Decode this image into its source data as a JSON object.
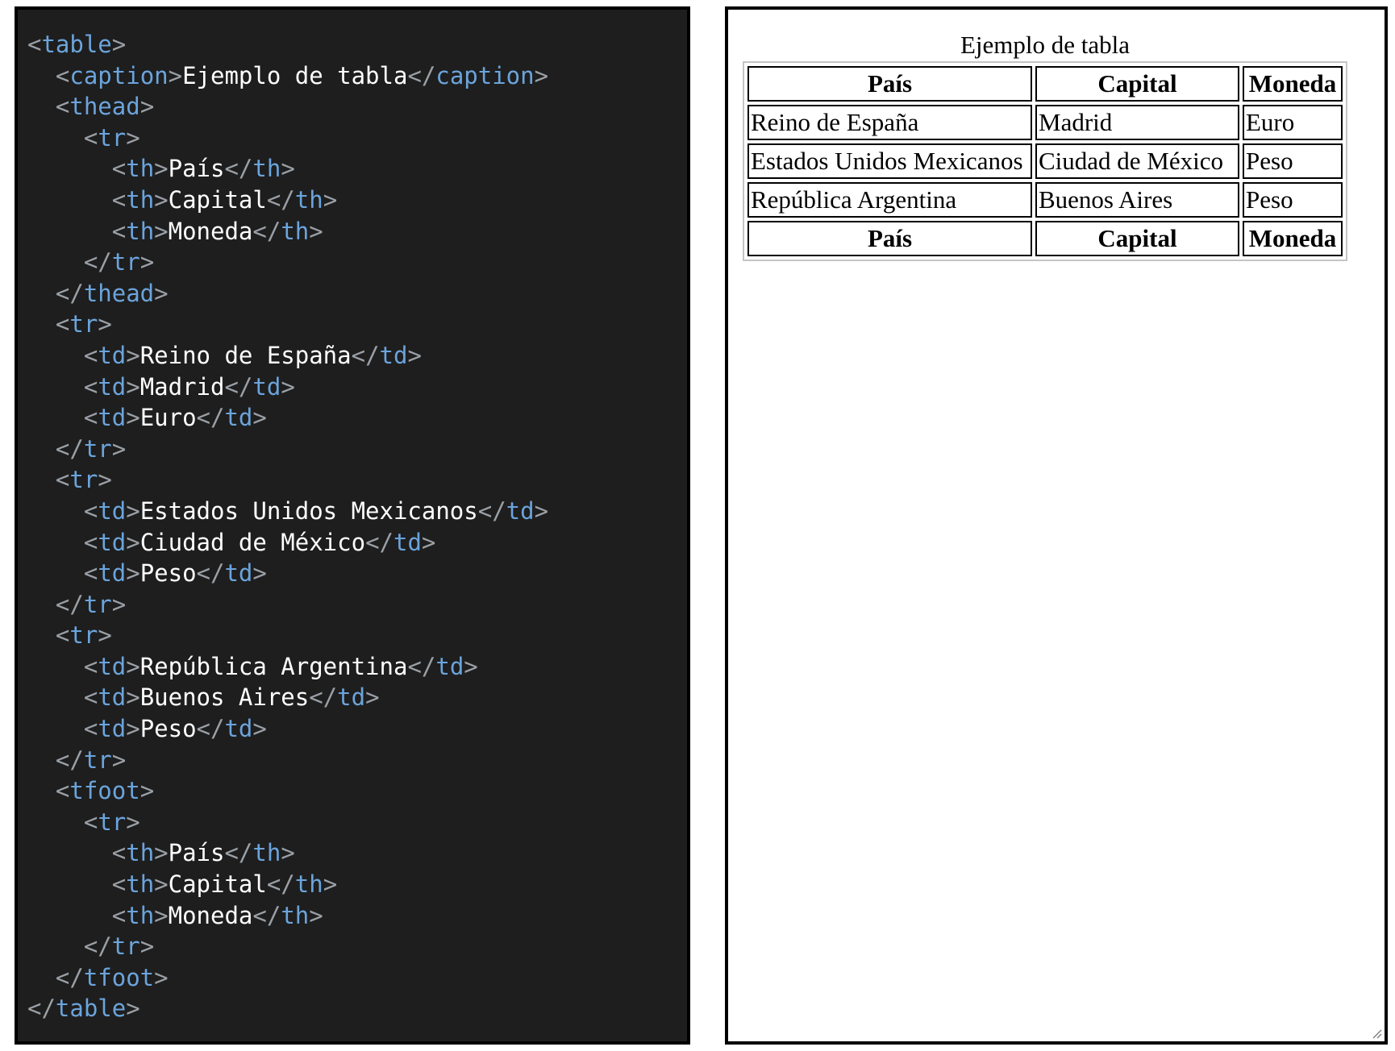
{
  "code_editor": {
    "lines": [
      {
        "indent": "",
        "parts": [
          [
            "p",
            "<"
          ],
          [
            "t",
            "table"
          ],
          [
            "p",
            ">"
          ]
        ]
      },
      {
        "indent": "  ",
        "parts": [
          [
            "p",
            "<"
          ],
          [
            "t",
            "caption"
          ],
          [
            "p",
            ">"
          ],
          [
            "x",
            "Ejemplo de tabla"
          ],
          [
            "p",
            "</"
          ],
          [
            "t",
            "caption"
          ],
          [
            "p",
            ">"
          ]
        ]
      },
      {
        "indent": "  ",
        "parts": [
          [
            "p",
            "<"
          ],
          [
            "t",
            "thead"
          ],
          [
            "p",
            ">"
          ]
        ]
      },
      {
        "indent": "    ",
        "parts": [
          [
            "p",
            "<"
          ],
          [
            "t",
            "tr"
          ],
          [
            "p",
            ">"
          ]
        ]
      },
      {
        "indent": "      ",
        "parts": [
          [
            "p",
            "<"
          ],
          [
            "t",
            "th"
          ],
          [
            "p",
            ">"
          ],
          [
            "x",
            "País"
          ],
          [
            "p",
            "</"
          ],
          [
            "t",
            "th"
          ],
          [
            "p",
            ">"
          ]
        ]
      },
      {
        "indent": "      ",
        "parts": [
          [
            "p",
            "<"
          ],
          [
            "t",
            "th"
          ],
          [
            "p",
            ">"
          ],
          [
            "x",
            "Capital"
          ],
          [
            "p",
            "</"
          ],
          [
            "t",
            "th"
          ],
          [
            "p",
            ">"
          ]
        ]
      },
      {
        "indent": "      ",
        "parts": [
          [
            "p",
            "<"
          ],
          [
            "t",
            "th"
          ],
          [
            "p",
            ">"
          ],
          [
            "x",
            "Moneda"
          ],
          [
            "p",
            "</"
          ],
          [
            "t",
            "th"
          ],
          [
            "p",
            ">"
          ]
        ]
      },
      {
        "indent": "    ",
        "parts": [
          [
            "p",
            "</"
          ],
          [
            "t",
            "tr"
          ],
          [
            "p",
            ">"
          ]
        ]
      },
      {
        "indent": "  ",
        "parts": [
          [
            "p",
            "</"
          ],
          [
            "t",
            "thead"
          ],
          [
            "p",
            ">"
          ]
        ]
      },
      {
        "indent": "  ",
        "parts": [
          [
            "p",
            "<"
          ],
          [
            "t",
            "tr"
          ],
          [
            "p",
            ">"
          ]
        ]
      },
      {
        "indent": "    ",
        "parts": [
          [
            "p",
            "<"
          ],
          [
            "t",
            "td"
          ],
          [
            "p",
            ">"
          ],
          [
            "x",
            "Reino de España"
          ],
          [
            "p",
            "</"
          ],
          [
            "t",
            "td"
          ],
          [
            "p",
            ">"
          ]
        ]
      },
      {
        "indent": "    ",
        "parts": [
          [
            "p",
            "<"
          ],
          [
            "t",
            "td"
          ],
          [
            "p",
            ">"
          ],
          [
            "x",
            "Madrid"
          ],
          [
            "p",
            "</"
          ],
          [
            "t",
            "td"
          ],
          [
            "p",
            ">"
          ]
        ]
      },
      {
        "indent": "    ",
        "parts": [
          [
            "p",
            "<"
          ],
          [
            "t",
            "td"
          ],
          [
            "p",
            ">"
          ],
          [
            "x",
            "Euro"
          ],
          [
            "p",
            "</"
          ],
          [
            "t",
            "td"
          ],
          [
            "p",
            ">"
          ]
        ]
      },
      {
        "indent": "  ",
        "parts": [
          [
            "p",
            "</"
          ],
          [
            "t",
            "tr"
          ],
          [
            "p",
            ">"
          ]
        ]
      },
      {
        "indent": "  ",
        "parts": [
          [
            "p",
            "<"
          ],
          [
            "t",
            "tr"
          ],
          [
            "p",
            ">"
          ]
        ]
      },
      {
        "indent": "    ",
        "parts": [
          [
            "p",
            "<"
          ],
          [
            "t",
            "td"
          ],
          [
            "p",
            ">"
          ],
          [
            "x",
            "Estados Unidos Mexicanos"
          ],
          [
            "p",
            "</"
          ],
          [
            "t",
            "td"
          ],
          [
            "p",
            ">"
          ]
        ]
      },
      {
        "indent": "    ",
        "parts": [
          [
            "p",
            "<"
          ],
          [
            "t",
            "td"
          ],
          [
            "p",
            ">"
          ],
          [
            "x",
            "Ciudad de México"
          ],
          [
            "p",
            "</"
          ],
          [
            "t",
            "td"
          ],
          [
            "p",
            ">"
          ]
        ]
      },
      {
        "indent": "    ",
        "parts": [
          [
            "p",
            "<"
          ],
          [
            "t",
            "td"
          ],
          [
            "p",
            ">"
          ],
          [
            "x",
            "Peso"
          ],
          [
            "p",
            "</"
          ],
          [
            "t",
            "td"
          ],
          [
            "p",
            ">"
          ]
        ]
      },
      {
        "indent": "  ",
        "parts": [
          [
            "p",
            "</"
          ],
          [
            "t",
            "tr"
          ],
          [
            "p",
            ">"
          ]
        ]
      },
      {
        "indent": "  ",
        "parts": [
          [
            "p",
            "<"
          ],
          [
            "t",
            "tr"
          ],
          [
            "p",
            ">"
          ]
        ]
      },
      {
        "indent": "    ",
        "parts": [
          [
            "p",
            "<"
          ],
          [
            "t",
            "td"
          ],
          [
            "p",
            ">"
          ],
          [
            "x",
            "República Argentina"
          ],
          [
            "p",
            "</"
          ],
          [
            "t",
            "td"
          ],
          [
            "p",
            ">"
          ]
        ]
      },
      {
        "indent": "    ",
        "parts": [
          [
            "p",
            "<"
          ],
          [
            "t",
            "td"
          ],
          [
            "p",
            ">"
          ],
          [
            "x",
            "Buenos Aires"
          ],
          [
            "p",
            "</"
          ],
          [
            "t",
            "td"
          ],
          [
            "p",
            ">"
          ]
        ]
      },
      {
        "indent": "    ",
        "parts": [
          [
            "p",
            "<"
          ],
          [
            "t",
            "td"
          ],
          [
            "p",
            ">"
          ],
          [
            "x",
            "Peso"
          ],
          [
            "p",
            "</"
          ],
          [
            "t",
            "td"
          ],
          [
            "p",
            ">"
          ]
        ]
      },
      {
        "indent": "  ",
        "parts": [
          [
            "p",
            "</"
          ],
          [
            "t",
            "tr"
          ],
          [
            "p",
            ">"
          ]
        ]
      },
      {
        "indent": "  ",
        "parts": [
          [
            "p",
            "<"
          ],
          [
            "t",
            "tfoot"
          ],
          [
            "p",
            ">"
          ]
        ]
      },
      {
        "indent": "    ",
        "parts": [
          [
            "p",
            "<"
          ],
          [
            "t",
            "tr"
          ],
          [
            "p",
            ">"
          ]
        ]
      },
      {
        "indent": "      ",
        "parts": [
          [
            "p",
            "<"
          ],
          [
            "t",
            "th"
          ],
          [
            "p",
            ">"
          ],
          [
            "x",
            "País"
          ],
          [
            "p",
            "</"
          ],
          [
            "t",
            "th"
          ],
          [
            "p",
            ">"
          ]
        ]
      },
      {
        "indent": "      ",
        "parts": [
          [
            "p",
            "<"
          ],
          [
            "t",
            "th"
          ],
          [
            "p",
            ">"
          ],
          [
            "x",
            "Capital"
          ],
          [
            "p",
            "</"
          ],
          [
            "t",
            "th"
          ],
          [
            "p",
            ">"
          ]
        ]
      },
      {
        "indent": "      ",
        "parts": [
          [
            "p",
            "<"
          ],
          [
            "t",
            "th"
          ],
          [
            "p",
            ">"
          ],
          [
            "x",
            "Moneda"
          ],
          [
            "p",
            "</"
          ],
          [
            "t",
            "th"
          ],
          [
            "p",
            ">"
          ]
        ]
      },
      {
        "indent": "    ",
        "parts": [
          [
            "p",
            "</"
          ],
          [
            "t",
            "tr"
          ],
          [
            "p",
            ">"
          ]
        ]
      },
      {
        "indent": "  ",
        "parts": [
          [
            "p",
            "</"
          ],
          [
            "t",
            "tfoot"
          ],
          [
            "p",
            ">"
          ]
        ]
      },
      {
        "indent": "",
        "parts": [
          [
            "p",
            "</"
          ],
          [
            "t",
            "table"
          ],
          [
            "p",
            ">"
          ]
        ]
      }
    ],
    "colors": {
      "background": "#1e1e1e",
      "punctuation": "#9aa0a6",
      "tag": "#6ba4dc",
      "text": "#ffffff"
    }
  },
  "preview": {
    "caption": "Ejemplo de tabla",
    "header": {
      "country": "País",
      "capital": "Capital",
      "currency": "Moneda"
    },
    "rows": [
      {
        "country": "Reino de España",
        "capital": "Madrid",
        "currency": "Euro"
      },
      {
        "country": "Estados Unidos Mexicanos",
        "capital": "Ciudad de México",
        "currency": "Peso"
      },
      {
        "country": "República Argentina",
        "capital": "Buenos Aires",
        "currency": "Peso"
      }
    ],
    "footer": {
      "country": "País",
      "capital": "Capital",
      "currency": "Moneda"
    },
    "resize_icon": "resize-grip-icon"
  }
}
